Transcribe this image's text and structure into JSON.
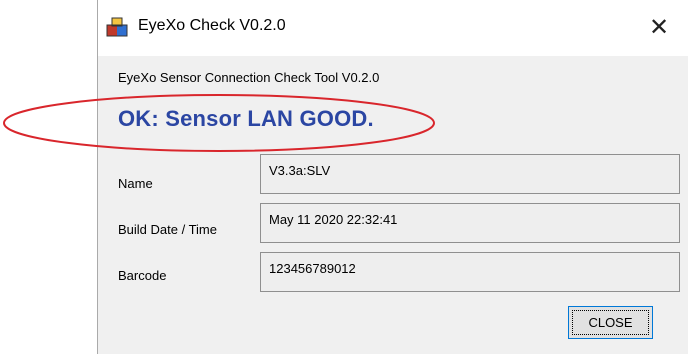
{
  "window": {
    "title": "EyeXo Check V0.2.0",
    "close_glyph": "✕",
    "icon": "app-icon"
  },
  "main": {
    "description": "EyeXo Sensor Connection Check Tool V0.2.0",
    "status_text": "OK: Sensor LAN GOOD.",
    "status_color": "#2b46a3",
    "fields": [
      {
        "label": "Name",
        "value": "V3.3a:SLV"
      },
      {
        "label": "Build Date / Time",
        "value": "May 11 2020 22:32:41"
      },
      {
        "label": "Barcode",
        "value": "123456789012"
      }
    ],
    "close_button_label": "CLOSE"
  },
  "annotation_color": "#d9262c"
}
